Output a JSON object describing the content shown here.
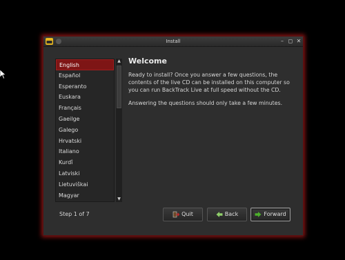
{
  "window": {
    "title": "Install",
    "controls": [
      "minimize",
      "maximize",
      "close"
    ]
  },
  "languages": {
    "items": [
      "English",
      "Español",
      "Esperanto",
      "Euskara",
      "Français",
      "Gaeilge",
      "Galego",
      "Hrvatski",
      "Italiano",
      "Kurdî",
      "Latviski",
      "Lietuviškai",
      "Magyar"
    ],
    "selected": "English"
  },
  "welcome": {
    "title": "Welcome",
    "paragraph1": "Ready to install?  Once you answer a few questions, the contents of the live CD can be installed on this computer so you can run BackTrack Live at full speed without the CD.",
    "paragraph2": "Answering the questions should only take a few minutes."
  },
  "footer": {
    "step": "Step 1 of 7",
    "quit": "Quit",
    "back": "Back",
    "forward": "Forward"
  },
  "colors": {
    "selection": "#7e1515",
    "window_glow": "#8a1414",
    "forward_icon": "#4caf2a",
    "back_icon": "#8fcf6a",
    "quit_icon": "#c62828"
  },
  "icons": {
    "app": "backtrack-icon",
    "quit": "exit-door-icon",
    "back": "arrow-left-icon",
    "forward": "arrow-right-icon"
  }
}
